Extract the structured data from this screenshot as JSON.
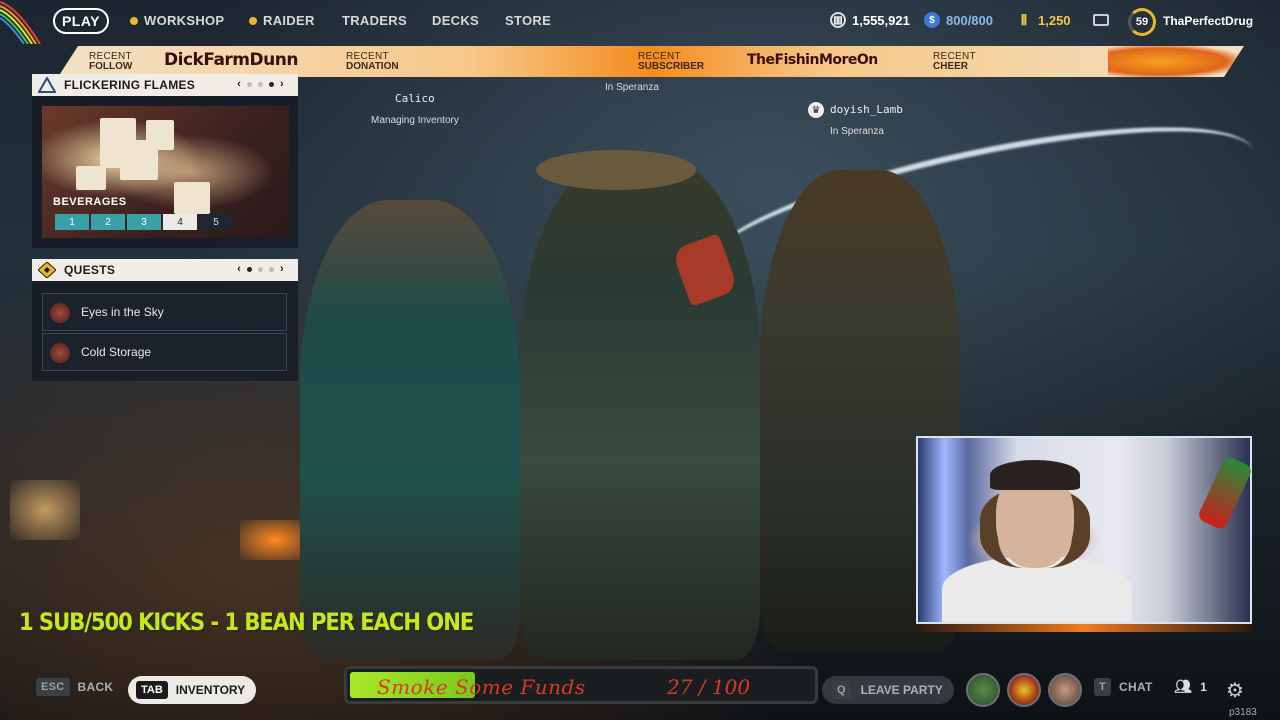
{
  "topbar": {
    "play": "PLAY",
    "nav": [
      "WORKSHOP",
      "RAIDER",
      "TRADERS",
      "DECKS",
      "STORE"
    ],
    "currencies": [
      {
        "icon": "coin-stack-icon",
        "value": "1,555,921"
      },
      {
        "icon": "raider-token-icon",
        "value": "800/800"
      },
      {
        "icon": "credits-icon",
        "value": "1,250"
      }
    ],
    "level": "59",
    "username": "ThaPerfectDrug"
  },
  "ticker": {
    "items": [
      {
        "small": "Recent",
        "big": "FOLLOW",
        "name": "DickFarmDunn"
      },
      {
        "small": "Recent",
        "big": "DONATION",
        "name": ""
      },
      {
        "small": "Recent",
        "big": "SUBSCRIBER",
        "name": "TheFishinMoreOn"
      },
      {
        "small": "Recent",
        "big": "CHEER",
        "name": ""
      }
    ]
  },
  "event_panel": {
    "title": "FLICKERING FLAMES",
    "category": "BEVERAGES",
    "tiers": [
      "1",
      "2",
      "3",
      "4",
      "5"
    ],
    "active_tier": "4",
    "page_active": 3,
    "page_total": 3
  },
  "quests_panel": {
    "title": "QUESTS",
    "items": [
      "Eyes in the Sky",
      "Cold Storage"
    ],
    "page_active": 2,
    "page_total": 3
  },
  "players": [
    {
      "name": "Calico",
      "status": "Managing Inventory"
    },
    {
      "name": "",
      "status": "In Speranza"
    },
    {
      "name": "doyish_Lamb",
      "status": "In Speranza"
    }
  ],
  "promo": "1 SUB/500 KICKS - 1 BEAN PER EACH ONE",
  "goal": {
    "name": "Smoke Some Funds",
    "current": 27,
    "target": 100,
    "count_text": "27 / 100"
  },
  "bottombar": {
    "back_key": "ESC",
    "back": "BACK",
    "inventory_key": "TAB",
    "inventory": "INVENTORY",
    "leave_key": "Q",
    "leave": "LEAVE PARTY",
    "chat_key": "T",
    "chat": "CHAT",
    "party_count": "1",
    "build": "p3183"
  },
  "colors": {
    "accent": "#e8b82a",
    "promo": "#c6e61e",
    "goal_fill": "#a8e82a",
    "goal_text": "#d83a2a"
  }
}
